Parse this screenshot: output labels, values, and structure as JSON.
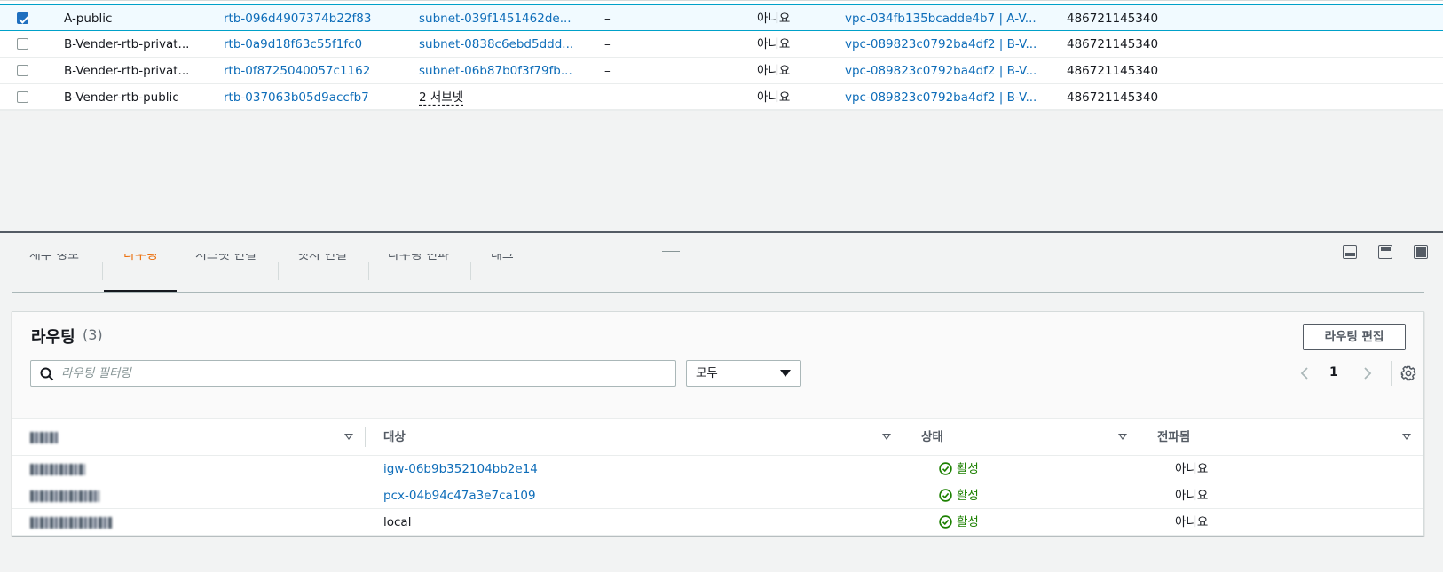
{
  "route_tables": [
    {
      "selected": true,
      "name": "A-public",
      "id": "rtb-096d4907374b22f83",
      "subnet": "subnet-039f1451462de...",
      "subnet_is_link": true,
      "edge": "–",
      "main": "아니요",
      "vpc": "vpc-034fb135bcadde4b7 | A-V...",
      "owner": "486721145340"
    },
    {
      "selected": false,
      "name": "B-Vender-rtb-privat...",
      "id": "rtb-0a9d18f63c55f1fc0",
      "subnet": "subnet-0838c6ebd5ddd...",
      "subnet_is_link": true,
      "edge": "–",
      "main": "아니요",
      "vpc": "vpc-089823c0792ba4df2 | B-V...",
      "owner": "486721145340"
    },
    {
      "selected": false,
      "name": "B-Vender-rtb-privat...",
      "id": "rtb-0f8725040057c1162",
      "subnet": "subnet-06b87b0f3f79fb...",
      "subnet_is_link": true,
      "edge": "–",
      "main": "아니요",
      "vpc": "vpc-089823c0792ba4df2 | B-V...",
      "owner": "486721145340"
    },
    {
      "selected": false,
      "name": "B-Vender-rtb-public",
      "id": "rtb-037063b05d9accfb7",
      "subnet": "2 서브넷",
      "subnet_is_link": false,
      "edge": "–",
      "main": "아니요",
      "vpc": "vpc-089823c0792ba4df2 | B-V...",
      "owner": "486721145340"
    }
  ],
  "tabs": [
    {
      "label": "세부 정보",
      "active": false
    },
    {
      "label": "라우팅",
      "active": true
    },
    {
      "label": "서브넷 연결",
      "active": false
    },
    {
      "label": "엣지 연결",
      "active": false
    },
    {
      "label": "라우팅 전파",
      "active": false
    },
    {
      "label": "태그",
      "active": false
    }
  ],
  "routes_panel": {
    "title": "라우팅",
    "count": "(3)",
    "edit_button": "라우팅 편집",
    "search_placeholder": "라우팅 필터링",
    "filter_select": "모두",
    "page": "1",
    "columns": [
      "대상",
      "대상",
      "상태",
      "전파됨"
    ],
    "rows": [
      {
        "target": "igw-06b9b352104bb2e14",
        "target_is_link": true,
        "status": "활성",
        "propagated": "아니요"
      },
      {
        "target": "pcx-04b94c47a3e7ca109",
        "target_is_link": true,
        "status": "활성",
        "propagated": "아니요"
      },
      {
        "target": "local",
        "target_is_link": false,
        "status": "활성",
        "propagated": "아니요"
      }
    ]
  },
  "colors": {
    "link": "#0e6db9",
    "active_tab": "#ec7211",
    "status_active": "#1d8102",
    "selected_row_bg": "#f1faff"
  },
  "icons": [
    "search-icon",
    "caret-down-icon",
    "chevron-left-icon",
    "chevron-right-icon",
    "gear-icon",
    "check-circle-icon",
    "sort-caret-icon",
    "layout-icon"
  ]
}
